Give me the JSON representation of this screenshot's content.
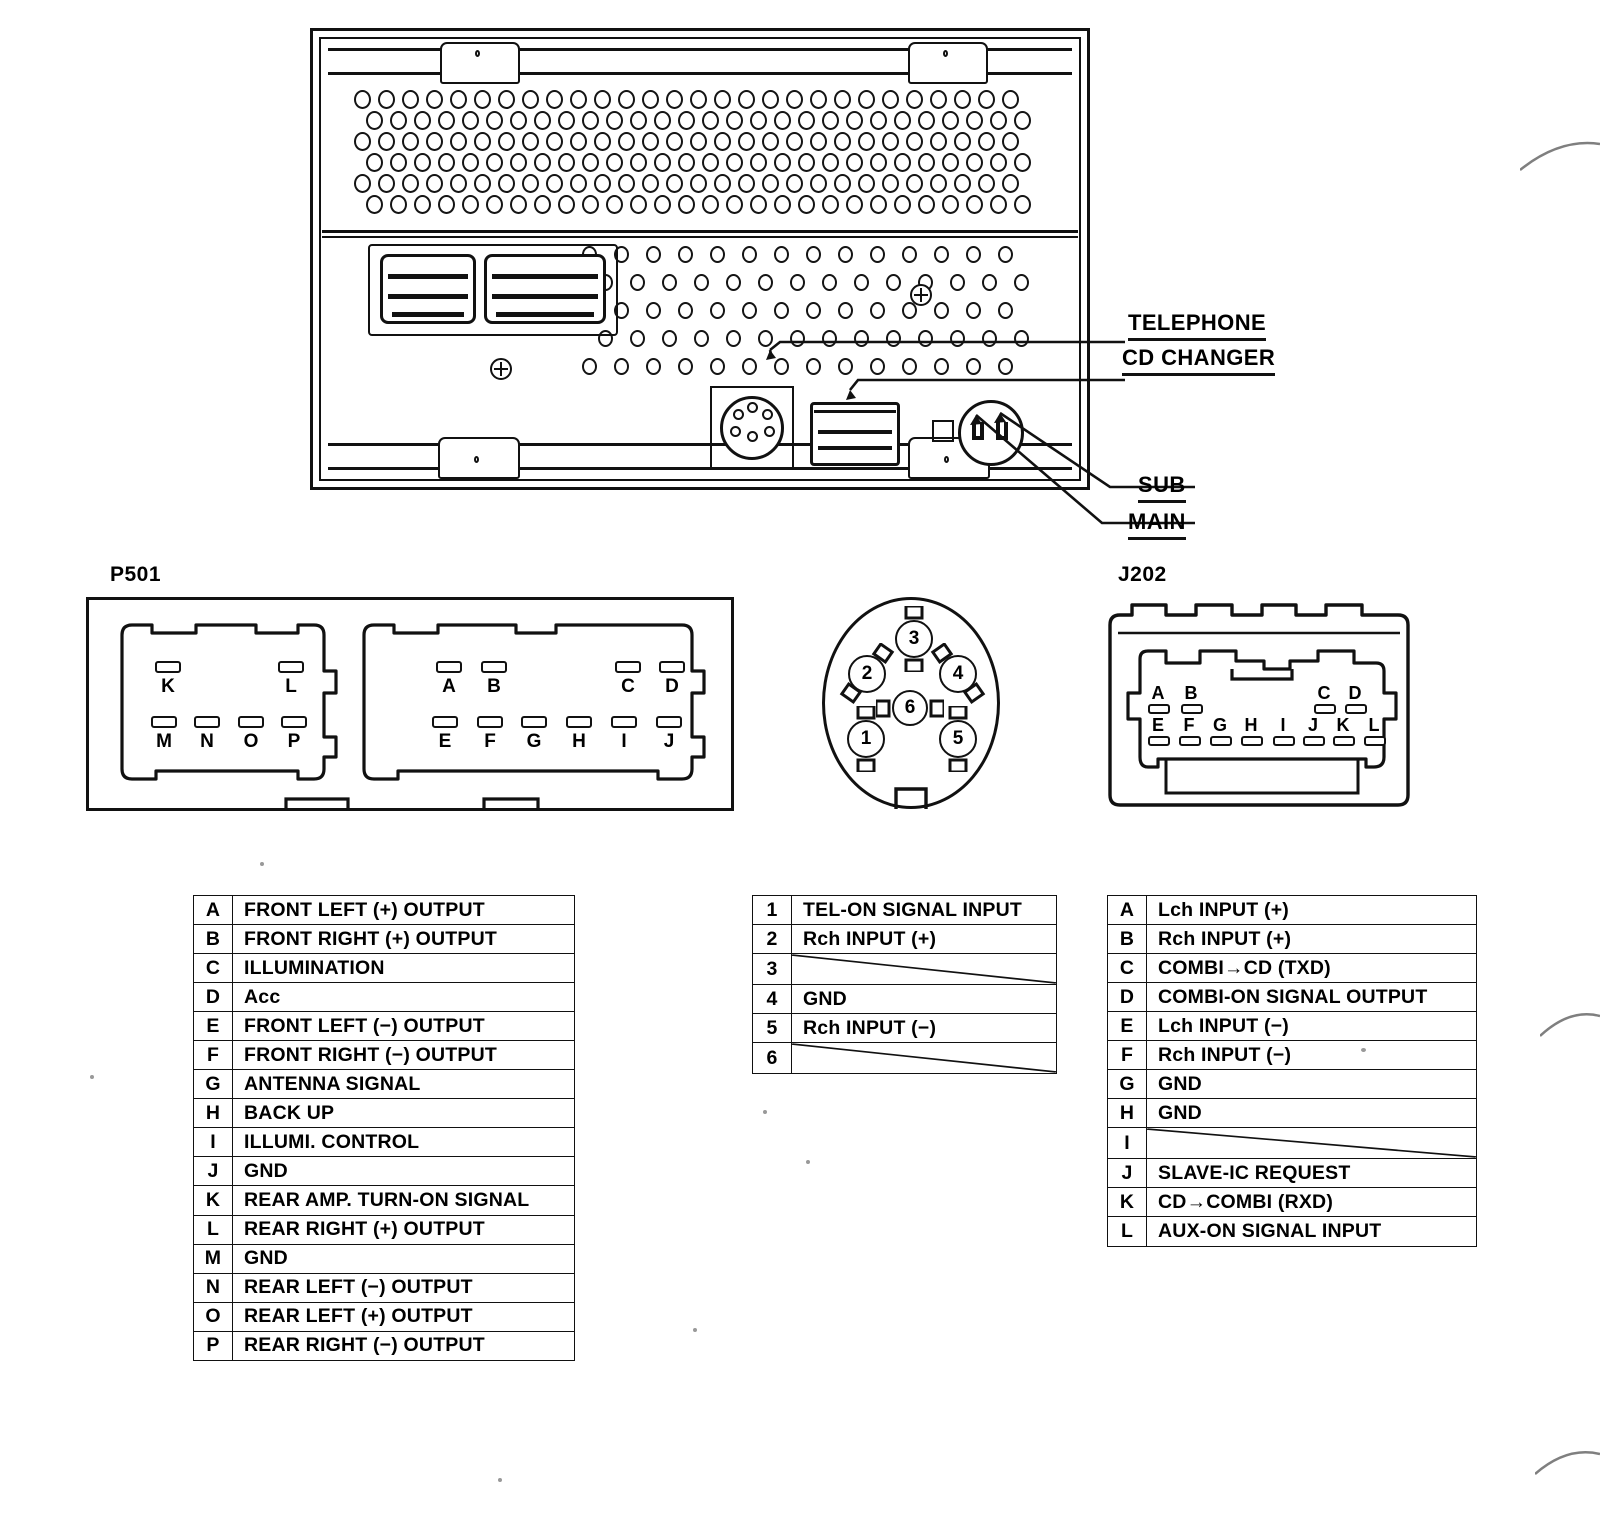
{
  "diagram": {
    "title": "Car audio head unit rear panel connector pinout",
    "callouts": [
      {
        "id": "telephone",
        "label": "TELEPHONE"
      },
      {
        "id": "cd-changer",
        "label": "CD CHANGER"
      },
      {
        "id": "sub",
        "label": "SUB"
      },
      {
        "id": "main",
        "label": "MAIN"
      }
    ]
  },
  "connectors": {
    "p501": {
      "title": "P501",
      "left_block": {
        "top_pins": [
          "K",
          "L"
        ],
        "bottom_pins": [
          "M",
          "N",
          "O",
          "P"
        ]
      },
      "right_block": {
        "top_pins": [
          "A",
          "B",
          "C",
          "D"
        ],
        "bottom_pins": [
          "E",
          "F",
          "G",
          "H",
          "I",
          "J"
        ]
      }
    },
    "din": {
      "title": "",
      "pins": [
        "1",
        "2",
        "3",
        "4",
        "5",
        "6"
      ]
    },
    "j202": {
      "title": "J202",
      "top_pins": [
        "A",
        "B",
        "C",
        "D"
      ],
      "bottom_pins": [
        "E",
        "F",
        "G",
        "H",
        "I",
        "J",
        "K",
        "L"
      ]
    }
  },
  "tables": {
    "p501": [
      {
        "pin": "A",
        "signal": "FRONT LEFT (+) OUTPUT"
      },
      {
        "pin": "B",
        "signal": "FRONT RIGHT (+) OUTPUT"
      },
      {
        "pin": "C",
        "signal": "ILLUMINATION"
      },
      {
        "pin": "D",
        "signal": "Acc"
      },
      {
        "pin": "E",
        "signal": "FRONT LEFT (−) OUTPUT"
      },
      {
        "pin": "F",
        "signal": "FRONT RIGHT (−) OUTPUT"
      },
      {
        "pin": "G",
        "signal": "ANTENNA SIGNAL"
      },
      {
        "pin": "H",
        "signal": "BACK UP"
      },
      {
        "pin": "I",
        "signal": "ILLUMI. CONTROL"
      },
      {
        "pin": "J",
        "signal": "GND"
      },
      {
        "pin": "K",
        "signal": "REAR AMP. TURN-ON SIGNAL"
      },
      {
        "pin": "L",
        "signal": "REAR RIGHT (+) OUTPUT"
      },
      {
        "pin": "M",
        "signal": "GND"
      },
      {
        "pin": "N",
        "signal": "REAR LEFT (−) OUTPUT"
      },
      {
        "pin": "O",
        "signal": "REAR LEFT (+) OUTPUT"
      },
      {
        "pin": "P",
        "signal": "REAR RIGHT (−) OUTPUT"
      }
    ],
    "din": [
      {
        "pin": "1",
        "signal": "TEL-ON SIGNAL INPUT"
      },
      {
        "pin": "2",
        "signal": "Rch INPUT (+)"
      },
      {
        "pin": "3",
        "signal": ""
      },
      {
        "pin": "4",
        "signal": "GND"
      },
      {
        "pin": "5",
        "signal": "Rch INPUT (−)"
      },
      {
        "pin": "6",
        "signal": ""
      }
    ],
    "j202": [
      {
        "pin": "A",
        "signal": "Lch INPUT (+)"
      },
      {
        "pin": "B",
        "signal": "Rch INPUT (+)"
      },
      {
        "pin": "C",
        "signal": "COMBI→CD (TXD)"
      },
      {
        "pin": "D",
        "signal": "COMBI-ON SIGNAL OUTPUT"
      },
      {
        "pin": "E",
        "signal": "Lch INPUT (−)"
      },
      {
        "pin": "F",
        "signal": "Rch INPUT (−)"
      },
      {
        "pin": "G",
        "signal": "GND"
      },
      {
        "pin": "H",
        "signal": "GND"
      },
      {
        "pin": "I",
        "signal": ""
      },
      {
        "pin": "J",
        "signal": "SLAVE-IC REQUEST"
      },
      {
        "pin": "K",
        "signal": "CD→COMBI (RXD)"
      },
      {
        "pin": "L",
        "signal": "AUX-ON SIGNAL INPUT"
      }
    ]
  },
  "colors": {
    "ink": "#111111",
    "paper": "#ffffff"
  }
}
